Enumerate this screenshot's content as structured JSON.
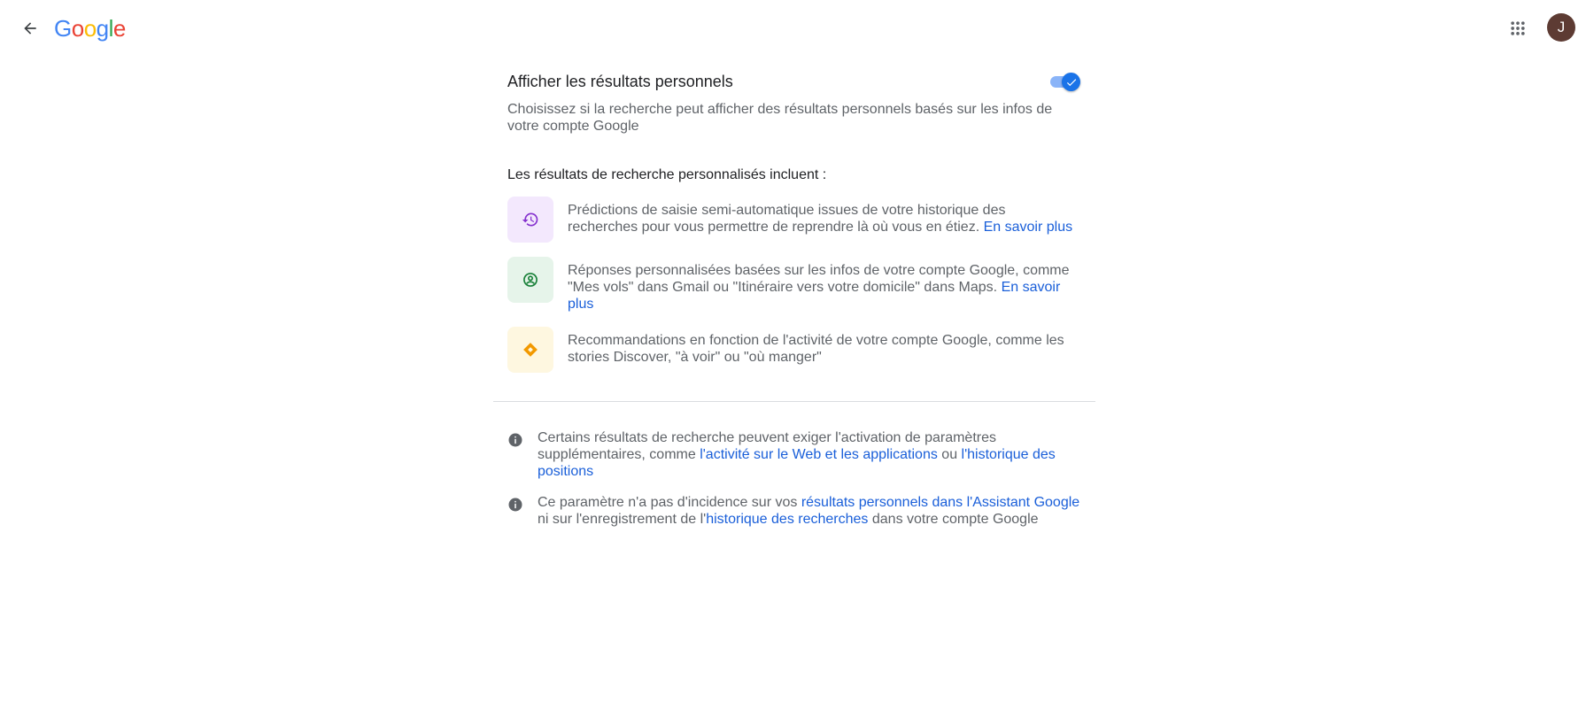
{
  "header": {
    "logo_letters": [
      {
        "char": "G",
        "color": "#4285F4"
      },
      {
        "char": "o",
        "color": "#EA4335"
      },
      {
        "char": "o",
        "color": "#FBBC05"
      },
      {
        "char": "g",
        "color": "#4285F4"
      },
      {
        "char": "l",
        "color": "#34A853"
      },
      {
        "char": "e",
        "color": "#EA4335"
      }
    ],
    "avatar_initial": "J",
    "avatar_color": "#5d3b33",
    "icons": {
      "back": "arrow-left-icon",
      "apps": "apps-grid-icon"
    }
  },
  "setting": {
    "title": "Afficher les résultats personnels",
    "toggle_on": true,
    "description": "Choisissez si la recherche peut afficher des résultats personnels basés sur les infos de votre compte Google"
  },
  "includes": {
    "title": "Les résultats de recherche personnalisés incluent :",
    "items": [
      {
        "icon": "history-icon",
        "icon_bg": "#f3e8fd",
        "icon_color": "#8430ce",
        "text": "Prédictions de saisie semi-automatique issues de votre historique des recherches pour vous permettre de reprendre là où vous en étiez.",
        "link": "En savoir plus"
      },
      {
        "icon": "account-circle-icon",
        "icon_bg": "#e6f4ea",
        "icon_color": "#188038",
        "text": "Réponses personnalisées basées sur les infos de votre compte Google, comme \"Mes vols\" dans Gmail ou \"Itinéraire vers votre domicile\" dans Maps.",
        "link": "En savoir plus"
      },
      {
        "icon": "discover-icon",
        "icon_bg": "#fef7e0",
        "icon_color": "#f29900",
        "text": "Recommandations en fonction de l'activité de votre compte Google, comme les stories Discover, \"à voir\" ou \"où manger\"",
        "link": ""
      }
    ]
  },
  "notes": [
    {
      "icon": "info-icon",
      "text_before": "Certains résultats de recherche peuvent exiger l'activation de paramètres supplémentaires, comme ",
      "link1": "l'activité sur le Web et les applications",
      "text_middle": " ou ",
      "link2": "l'historique des positions",
      "text_after": ""
    },
    {
      "icon": "info-icon",
      "text_before": "Ce paramètre n'a pas d'incidence sur vos ",
      "link1": "résultats personnels dans l'Assistant Google",
      "text_middle": " ni sur l'enregistrement de l'",
      "link2": "historique des recherches",
      "text_after": " dans votre compte Google"
    }
  ],
  "colors": {
    "link": "#1a5fd9",
    "toggle_active": "#1a73e8",
    "secondary_text": "#5f6368"
  }
}
